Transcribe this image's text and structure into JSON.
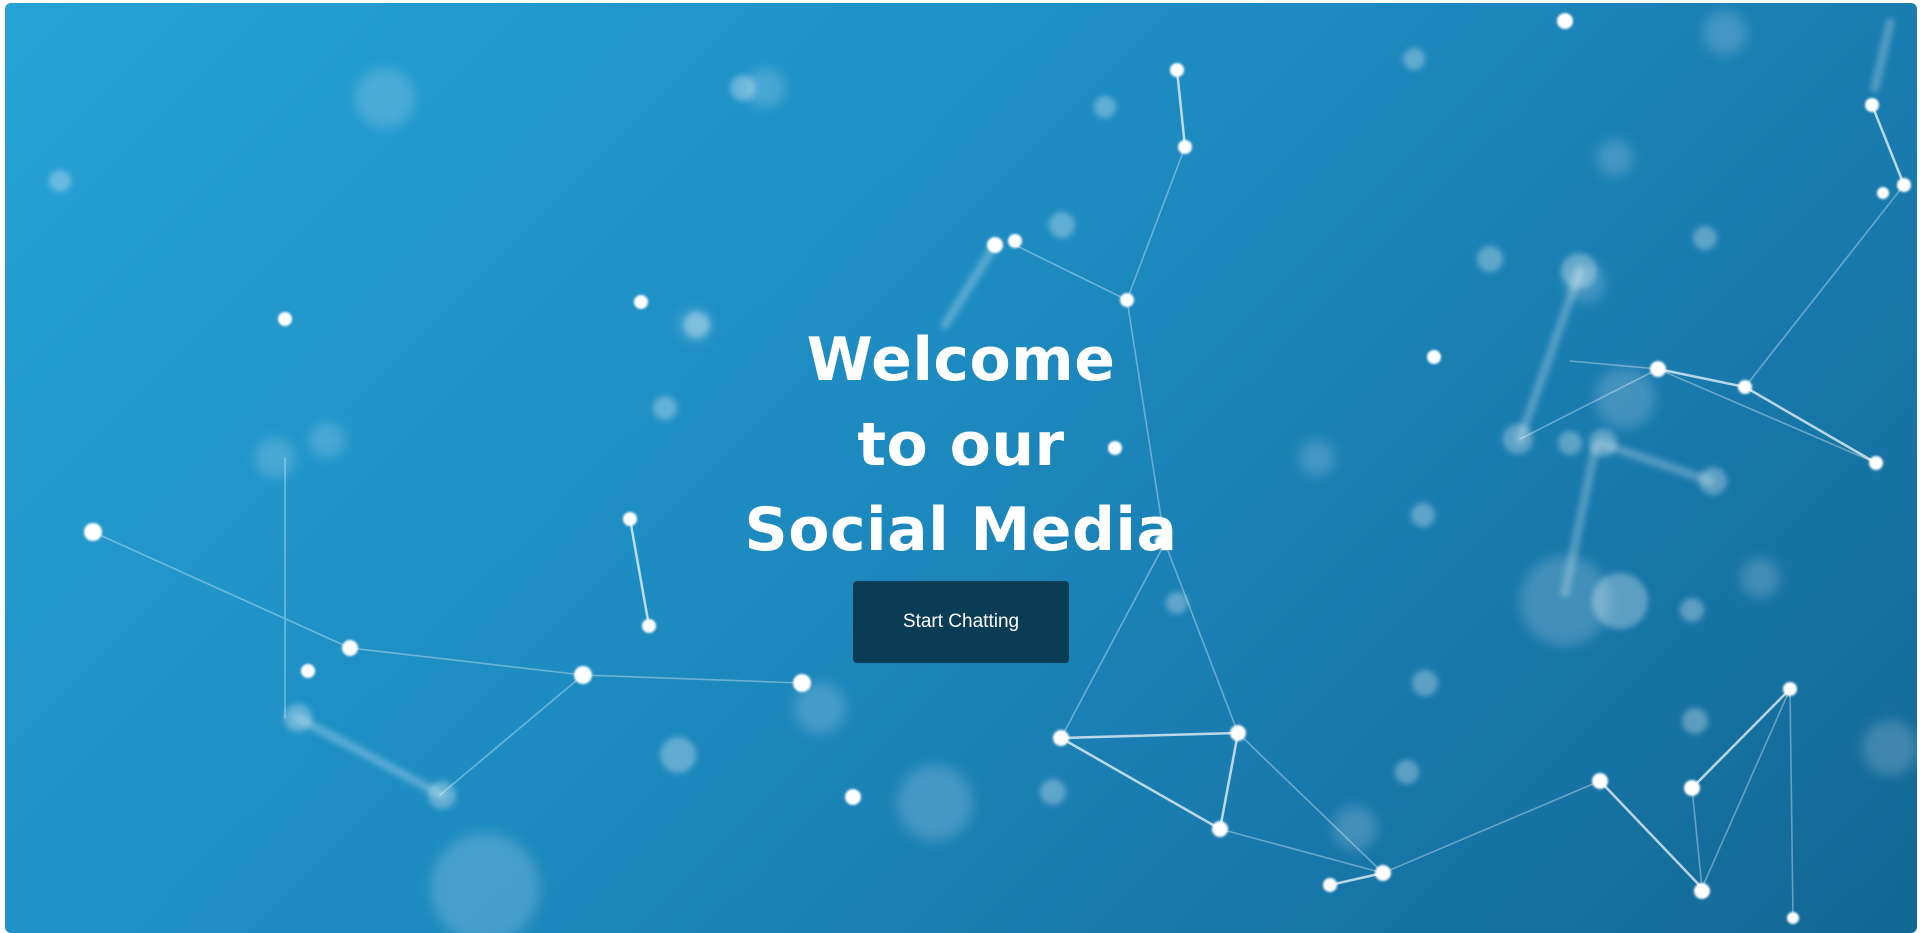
{
  "hero": {
    "title_lines": [
      "Welcome",
      "to our",
      "Social Media"
    ],
    "cta_label": "Start Chatting"
  },
  "theme": {
    "background_start": "#28a2d6",
    "background_end": "#126793",
    "button_color": "#0b3c56",
    "text_color": "#ffffff"
  },
  "decoration": "network-background"
}
